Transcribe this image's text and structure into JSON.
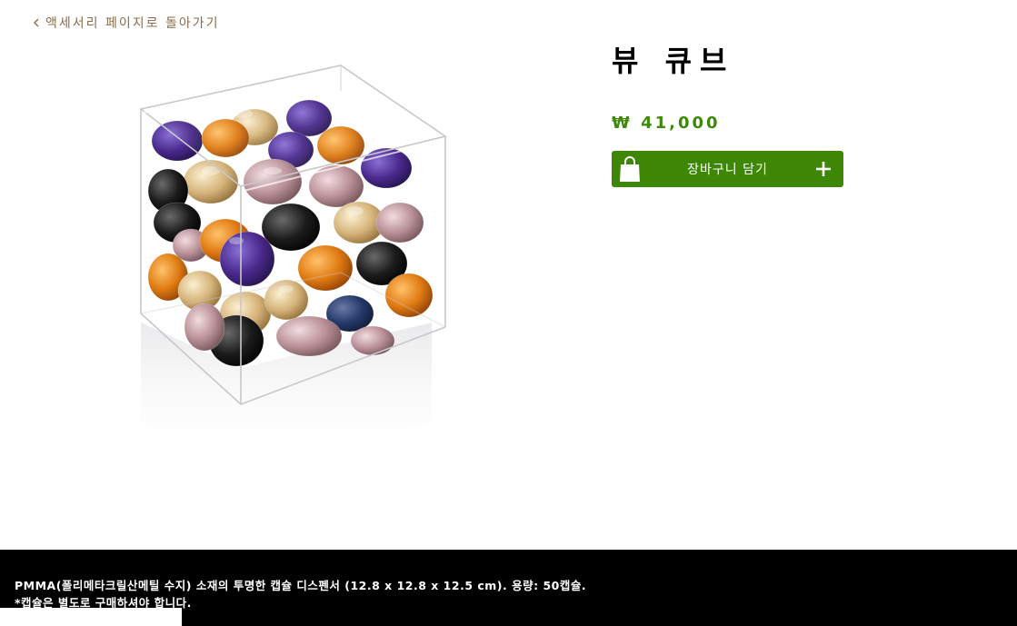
{
  "nav": {
    "back_label": "액세서리 페이지로 돌아가기"
  },
  "product": {
    "name": "뷰 큐브",
    "price": "₩ 41,000",
    "image_alt": "뷰 큐브"
  },
  "cart_button": {
    "label": "장바구니 담기",
    "icons": [
      "shopping-bag-icon",
      "plus-icon"
    ]
  },
  "description": {
    "line1": "PMMA(폴리메타크릴산메틸 수지) 소재의 투명한 캡슐 디스펜서 (12.8 x 12.8 x 12.5 cm). 용량: 50캡슐.",
    "line2": "*캡슐은 별도로 구매하셔야 합니다."
  },
  "colors": {
    "accent_green": "#3d8705",
    "price_green": "#3d8a0a",
    "back_link": "#8a6d4b",
    "footer_bg": "#000000"
  }
}
